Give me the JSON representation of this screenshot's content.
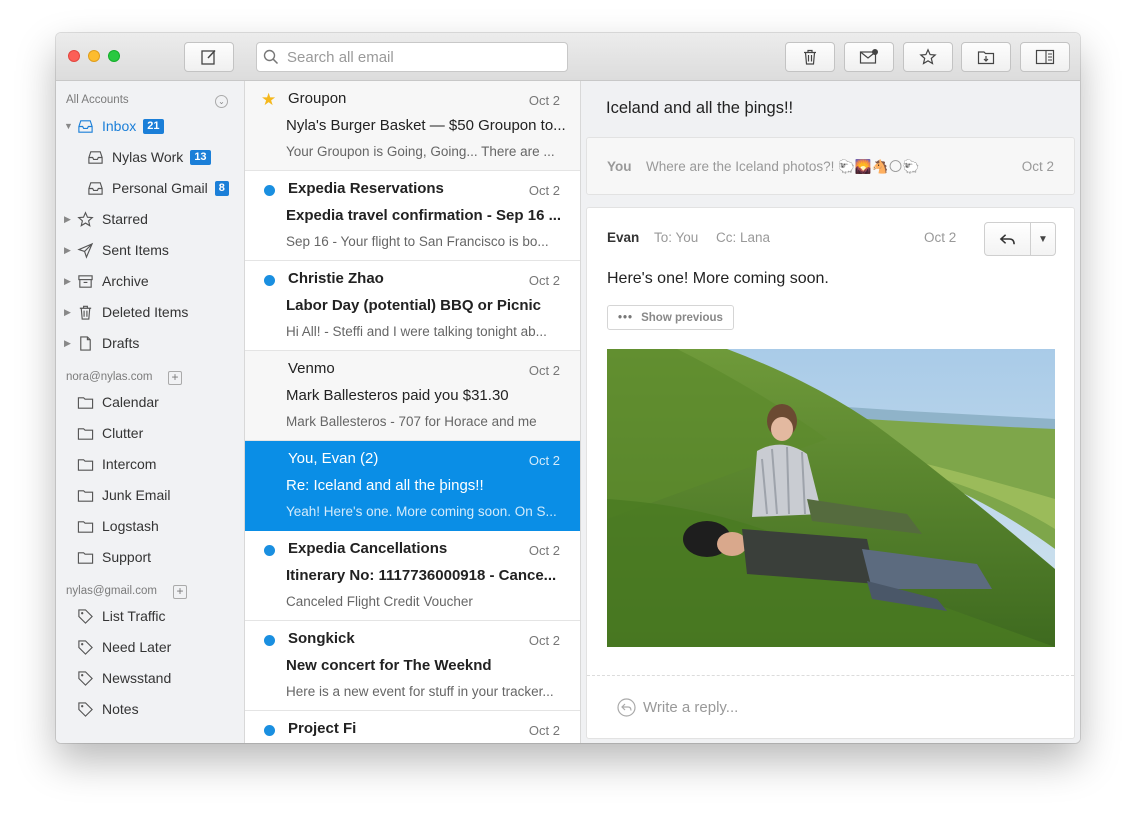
{
  "toolbar": {
    "search_placeholder": "Search all email"
  },
  "sidebar": {
    "all_accounts_label": "All Accounts",
    "inbox": {
      "label": "Inbox",
      "count": "21"
    },
    "sub_accounts": [
      {
        "label": "Nylas Work",
        "count": "13"
      },
      {
        "label": "Personal Gmail",
        "count": "8"
      }
    ],
    "folders": [
      {
        "label": "Starred"
      },
      {
        "label": "Sent Items"
      },
      {
        "label": "Archive"
      },
      {
        "label": "Deleted Items"
      },
      {
        "label": "Drafts"
      }
    ],
    "account1": {
      "email": "nora@nylas.com",
      "folders": [
        "Calendar",
        "Clutter",
        "Intercom",
        "Junk Email",
        "Logstash",
        "Support"
      ]
    },
    "account2": {
      "email": "nylas@gmail.com",
      "labels": [
        "List Traffic",
        "Need Later",
        "Newsstand",
        "Notes"
      ]
    }
  },
  "threads": [
    {
      "from": "Groupon",
      "date": "Oct 2",
      "subject": "Nyla's Burger Basket — $50 Groupon to...",
      "snippet": "Your Groupon is Going, Going... There are ..."
    },
    {
      "from": "Expedia Reservations",
      "date": "Oct 2",
      "subject": "Expedia travel confirmation - Sep 16 ...",
      "snippet": "Sep 16 - Your flight to San Francisco is bo..."
    },
    {
      "from": "Christie Zhao",
      "date": "Oct 2",
      "subject": "Labor Day (potential) BBQ or Picnic",
      "snippet": "Hi All! - Steffi and I were talking tonight ab..."
    },
    {
      "from": "Venmo",
      "date": "Oct 2",
      "subject": "Mark Ballesteros paid you $31.30",
      "snippet": "Mark Ballesteros - 707 for Horace and me"
    },
    {
      "from": "You, Evan (2)",
      "date": "Oct 2",
      "subject": "Re: Iceland and all the þings!!",
      "snippet": "Yeah! Here's one. More coming soon. On S..."
    },
    {
      "from": "Expedia Cancellations",
      "date": "Oct 2",
      "subject": "Itinerary No: 1117736000918 - Cance...",
      "snippet": "Canceled Flight Credit Voucher"
    },
    {
      "from": "Songkick",
      "date": "Oct 2",
      "subject": "New concert for The Weeknd",
      "snippet": "Here is a new event for stuff in your tracker..."
    },
    {
      "from": "Project Fi",
      "date": "Oct 2",
      "subject": "",
      "snippet": ""
    }
  ],
  "reader": {
    "title": "Iceland and all the þings!!",
    "collapsed": {
      "from": "You",
      "snippet": "Where are the Iceland photos?! 🐑🌄🐴🌕🐑",
      "date": "Oct 2"
    },
    "message": {
      "from": "Evan",
      "to": "To: You",
      "cc": "Cc: Lana",
      "date": "Oct 2",
      "body": "Here's one! More coming soon.",
      "show_previous": "Show previous"
    },
    "reply_placeholder": "Write a reply..."
  }
}
